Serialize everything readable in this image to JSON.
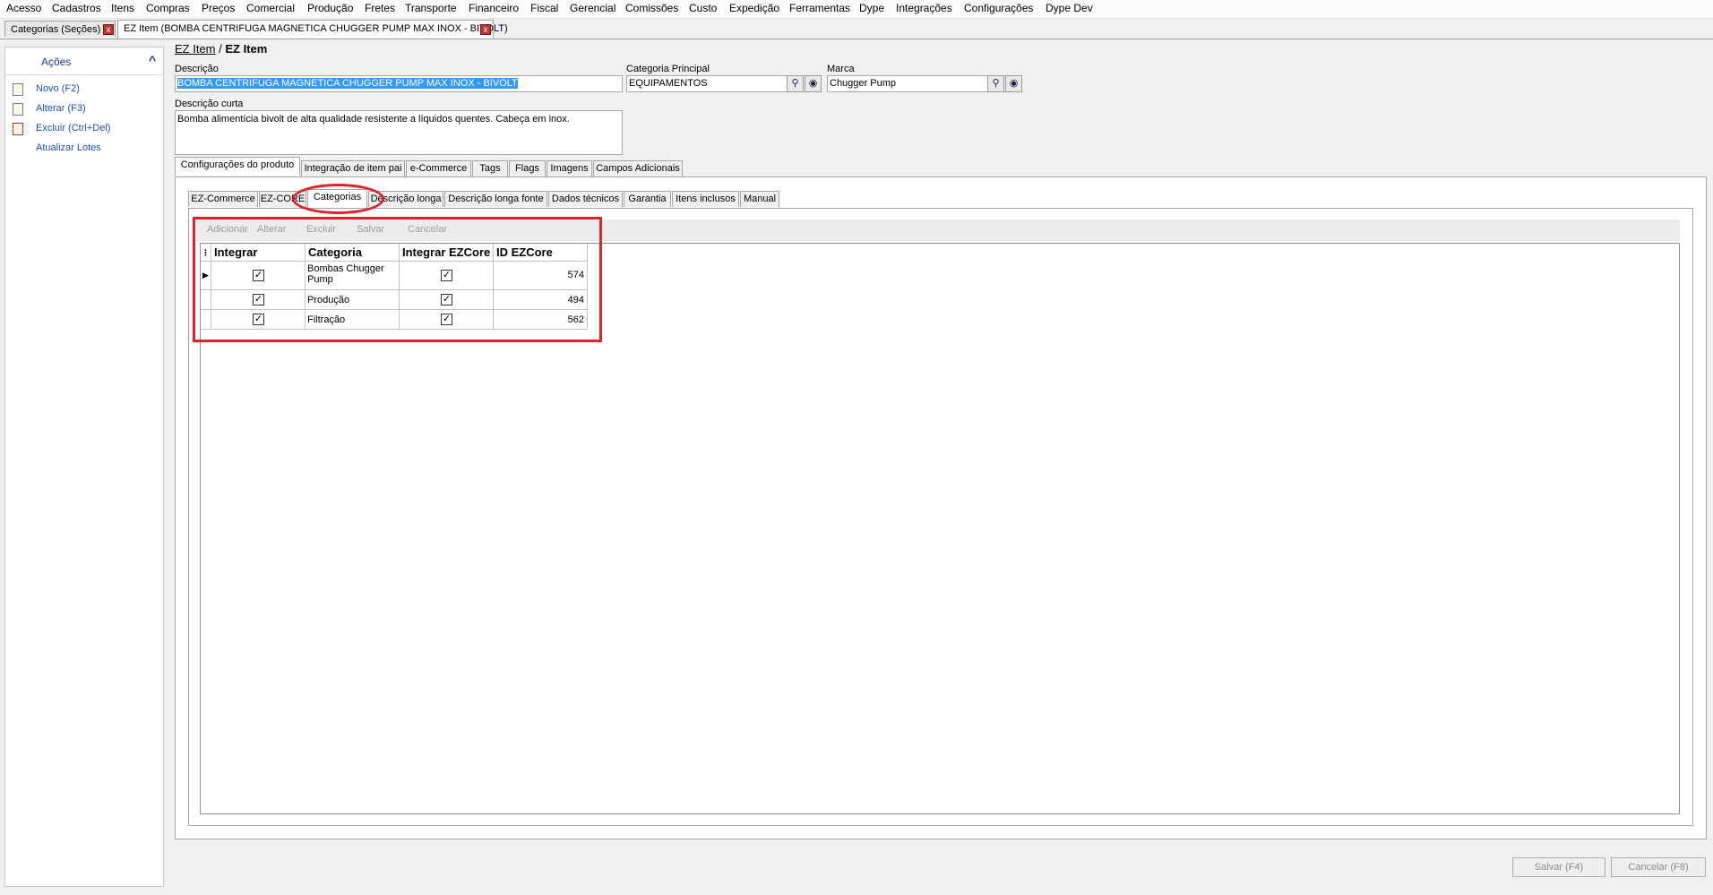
{
  "menu": [
    "Acesso",
    "Cadastros",
    "Itens",
    "Compras",
    "Preços",
    "Comercial",
    "Produção",
    "Fretes",
    "Transporte",
    "Financeiro",
    "Fiscal",
    "Gerencial",
    "Comissões",
    "Custo",
    "Expedição",
    "Ferramentas",
    "Dype",
    "Integrações",
    "Configurações",
    "Dype Dev"
  ],
  "doc_tabs": [
    {
      "label": "Categorias (Seções)",
      "close": "x"
    },
    {
      "label": "EZ Item (BOMBA CENTRIFUGA MAGNETICA CHUGGER PUMP MAX INOX - BIVOLT)",
      "close": "x"
    }
  ],
  "sidebar": {
    "title": "Ações",
    "chevron": "^",
    "items": [
      {
        "label": "Novo (F2)",
        "icon": "new-document-icon"
      },
      {
        "label": "Alterar (F3)",
        "icon": "edit-document-icon"
      },
      {
        "label": "Excluir (Ctrl+Del)",
        "icon": "delete-document-icon"
      },
      {
        "label": "Atualizar Lotes",
        "icon": ""
      }
    ]
  },
  "breadcrumb": {
    "link": "EZ Item",
    "separator": "/",
    "current": "EZ Item"
  },
  "form": {
    "descricao_label": "Descrição",
    "descricao_value": "BOMBA CENTRIFUGA MAGNETICA CHUGGER PUMP MAX INOX - BIVOLT",
    "categoria_label": "Categoria Principal",
    "categoria_value": "EQUIPAMENTOS",
    "marca_label": "Marca",
    "marca_value": "Chugger Pump",
    "desc_curta_label": "Descrição curta",
    "desc_curta_value": "Bomba alimentícia bivolt de alta qualidade resistente a líquidos quentes. Cabeça em inox."
  },
  "outer_tabs": [
    "Configurações do produto",
    "Integração de item pai",
    "e-Commerce",
    "Tags",
    "Flags",
    "Imagens",
    "Campos Adicionais"
  ],
  "inner_tabs": [
    "EZ-Commerce",
    "EZ-CORE",
    "Categorias",
    "Descrição longa",
    "Descrição longa fonte",
    "Dados técnicos",
    "Garantia",
    "Itens inclusos",
    "Manual"
  ],
  "grid_toolbar": [
    "Adicionar",
    "Alterar",
    "Excluir",
    "Salvar",
    "Cancelar"
  ],
  "grid": {
    "columns": [
      "Integrar",
      "Categoria",
      "Integrar EZCore",
      "ID EZCore"
    ],
    "rows": [
      {
        "integrar": true,
        "categoria": "Bombas Chugger Pump",
        "integrar_ezcore": true,
        "id": "574"
      },
      {
        "integrar": true,
        "categoria": "Produção",
        "integrar_ezcore": true,
        "id": "494"
      },
      {
        "integrar": true,
        "categoria": "Filtração",
        "integrar_ezcore": true,
        "id": "562"
      }
    ]
  },
  "footer": {
    "save": "Salvar (F4)",
    "cancel": "Cancelar (F8)"
  },
  "accent_color": "#e0202a"
}
